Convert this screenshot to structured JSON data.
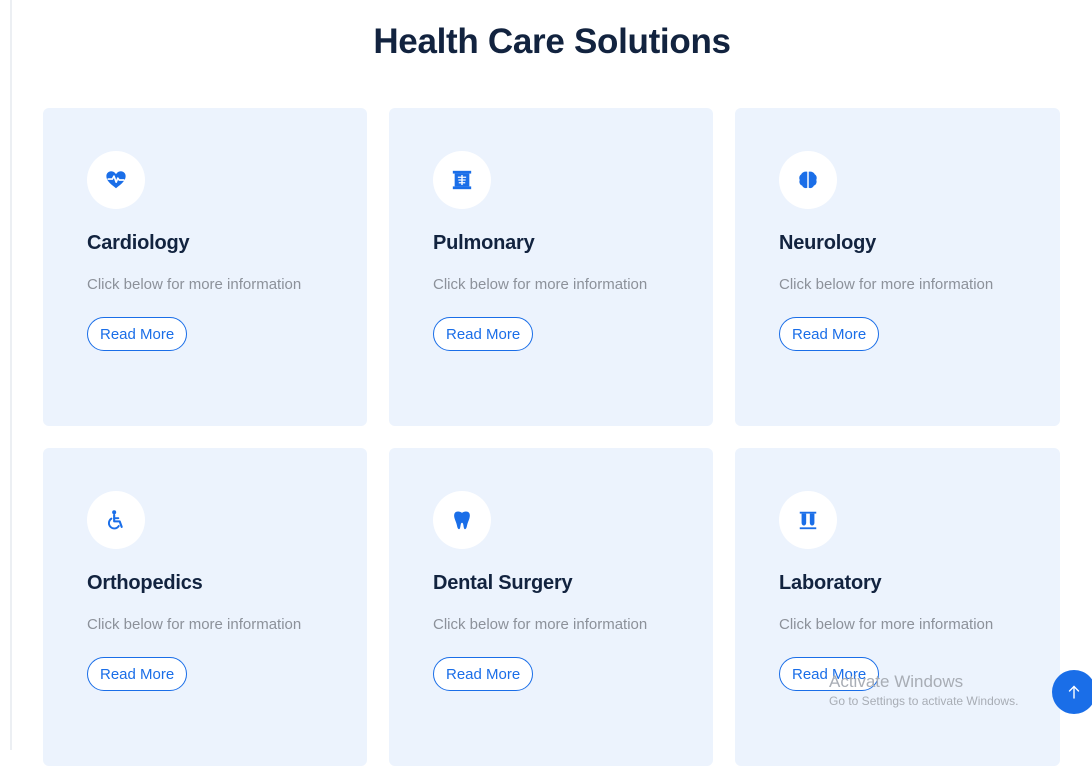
{
  "page": {
    "title": "Health Care Solutions"
  },
  "colors": {
    "accent": "#1a6ee8",
    "heading": "#12233f",
    "card_background": "#ecf3fd",
    "muted_text": "#8c919a"
  },
  "services": [
    {
      "icon": "heart-pulse-icon",
      "title": "Cardiology",
      "description": "Click below for more information",
      "button": "Read More"
    },
    {
      "icon": "xray-icon",
      "title": "Pulmonary",
      "description": "Click below for more information",
      "button": "Read More"
    },
    {
      "icon": "brain-icon",
      "title": "Neurology",
      "description": "Click below for more information",
      "button": "Read More"
    },
    {
      "icon": "wheelchair-icon",
      "title": "Orthopedics",
      "description": "Click below for more information",
      "button": "Read More"
    },
    {
      "icon": "tooth-icon",
      "title": "Dental Surgery",
      "description": "Click below for more information",
      "button": "Read More"
    },
    {
      "icon": "test-tubes-icon",
      "title": "Laboratory",
      "description": "Click below for more information",
      "button": "Read More"
    }
  ],
  "watermark": {
    "title": "Activate Windows",
    "subtitle": "Go to Settings to activate Windows."
  },
  "scroll_top": {
    "icon": "arrow-up-icon"
  }
}
